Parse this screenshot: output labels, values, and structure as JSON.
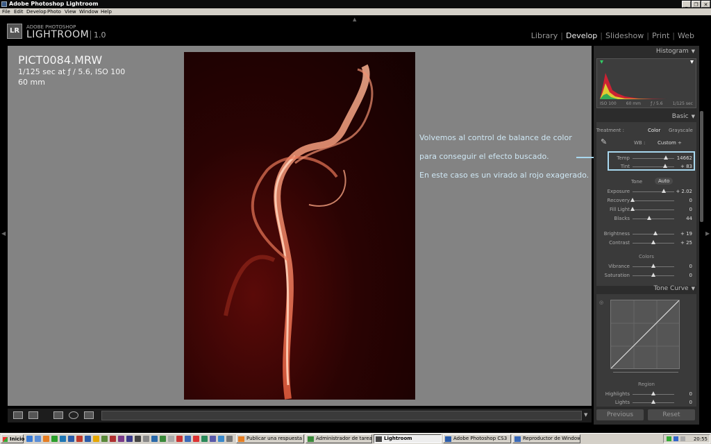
{
  "window": {
    "title": "Adobe Photoshop Lightroom",
    "minimize": "_",
    "restore": "❐",
    "close": "✕"
  },
  "menu": [
    "File",
    "Edit",
    "Develop",
    "Photo",
    "View",
    "Window",
    "Help"
  ],
  "identity": {
    "badge": "LR",
    "adobe": "ADOBE PHOTOSHOP",
    "product": "LIGHTROOM",
    "version": "1.0"
  },
  "modules": {
    "items": [
      "Library",
      "Develop",
      "Slideshow",
      "Print",
      "Web"
    ],
    "active": "Develop"
  },
  "photo_info": {
    "filename": "PICT0084.MRW",
    "exposure": "1/125 sec at ƒ / 5.6, ISO 100",
    "focal": "60 mm"
  },
  "annotation": {
    "line1": "Volvemos al control de balance de color",
    "line2": "para conseguir el efecto buscado.",
    "line3": "En este caso es un virado al rojo exagerado.",
    "color": "#a8d8ef"
  },
  "histogram": {
    "title": "Histogram",
    "iso": "ISO 100",
    "focal": "60 mm",
    "aperture": "ƒ / 5.6",
    "shutter": "1/125 sec"
  },
  "basic": {
    "title": "Basic",
    "treatment_label": "Treatment :",
    "treatment_color": "Color",
    "treatment_gray": "Grayscale",
    "wb_label": "WB :",
    "wb_value": "Custom ÷",
    "tone_label": "Tone",
    "auto_label": "Auto",
    "colors_label": "Colors",
    "sliders": {
      "temp": {
        "label": "Temp",
        "value": "14662",
        "pos": 0.8
      },
      "tint": {
        "label": "Tint",
        "value": "+ 83",
        "pos": 0.78
      },
      "exposure": {
        "label": "Exposure",
        "value": "+ 2.02",
        "pos": 0.75
      },
      "recovery": {
        "label": "Recovery",
        "value": "0",
        "pos": 0.0
      },
      "filllight": {
        "label": "Fill Light",
        "value": "0",
        "pos": 0.0
      },
      "blacks": {
        "label": "Blacks",
        "value": "44",
        "pos": 0.4
      },
      "brightness": {
        "label": "Brightness",
        "value": "+ 19",
        "pos": 0.55
      },
      "contrast": {
        "label": "Contrast",
        "value": "+ 25",
        "pos": 0.5
      },
      "vibrance": {
        "label": "Vibrance",
        "value": "0",
        "pos": 0.5
      },
      "saturation": {
        "label": "Saturation",
        "value": "0",
        "pos": 0.5
      }
    }
  },
  "tone_curve": {
    "title": "Tone Curve",
    "region_label": "Region",
    "highlights": {
      "label": "Highlights",
      "value": "0",
      "pos": 0.5
    },
    "lights": {
      "label": "Lights",
      "value": "0",
      "pos": 0.5
    }
  },
  "buttons": {
    "previous": "Previous",
    "reset": "Reset"
  },
  "taskbar": {
    "start": "Inicio",
    "tasks": [
      {
        "label": "Publicar una respuesta - ..."
      },
      {
        "label": "Administrador de tareas ..."
      },
      {
        "label": "Lightroom"
      },
      {
        "label": "Adobe Photoshop CS3"
      },
      {
        "label": "Reproductor de Window..."
      }
    ],
    "clock": "20:55"
  }
}
